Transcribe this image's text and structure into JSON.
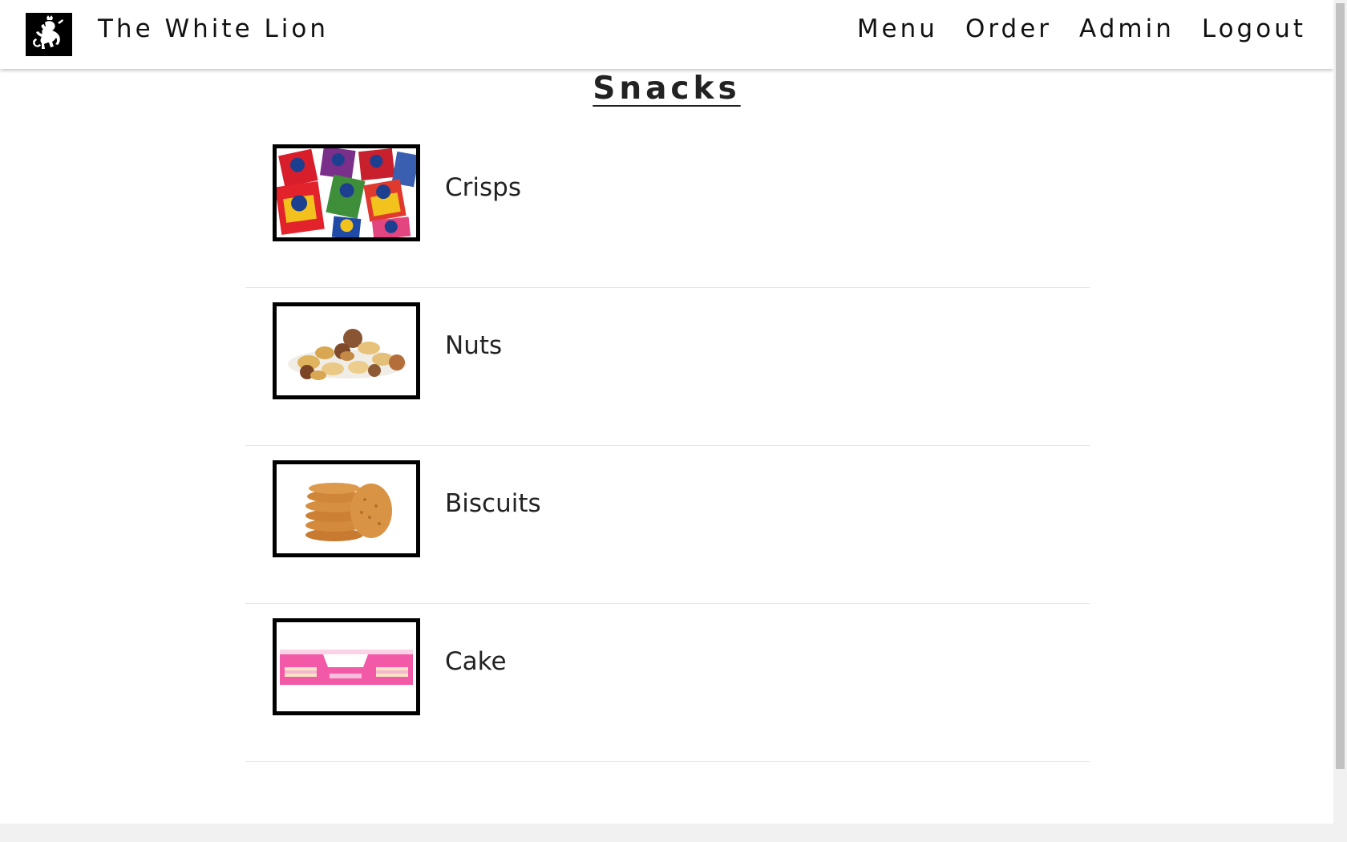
{
  "navbar": {
    "logo_icon": "lion-rampant-icon",
    "brand": "The White Lion",
    "links": [
      "Menu",
      "Order",
      "Admin",
      "Logout"
    ]
  },
  "page": {
    "title": "Snacks"
  },
  "items": [
    {
      "label": "Crisps",
      "image": "kp-crisps-packets-image"
    },
    {
      "label": "Nuts",
      "image": "mixed-nuts-image"
    },
    {
      "label": "Biscuits",
      "image": "biscuit-stack-image"
    },
    {
      "label": "Cake",
      "image": "mr-kipling-cake-box-image"
    }
  ],
  "colors": {
    "background": "#ffffff",
    "text": "#222222",
    "thumb_border": "#000000",
    "divider": "#e6e6e6"
  }
}
